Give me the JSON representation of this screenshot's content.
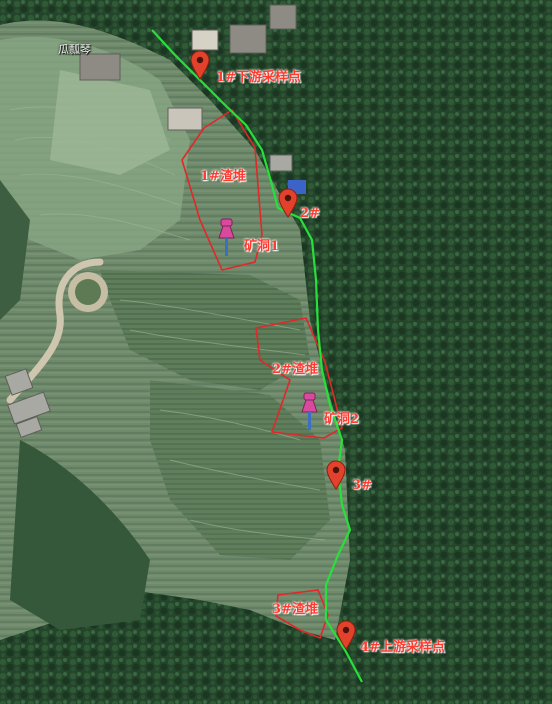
{
  "map": {
    "village_name": "瓜瓢琴",
    "colors": {
      "stream": "#27e03a",
      "waste_outline": "#e0282a",
      "sample_pin": "#e2422b",
      "mine_pin": "#d94a9e",
      "label_text": "#ff3b30"
    },
    "sampling_points": [
      {
        "id": "sp1",
        "label": "1#下游采样点",
        "icon": "map-pin-icon"
      },
      {
        "id": "sp2",
        "label": "2#",
        "icon": "map-pin-icon"
      },
      {
        "id": "sp3",
        "label": "3#",
        "icon": "map-pin-icon"
      },
      {
        "id": "sp4",
        "label": "4#上游采样点",
        "icon": "map-pin-icon"
      }
    ],
    "waste_piles": [
      {
        "id": "w1",
        "label": "1#渣堆"
      },
      {
        "id": "w2",
        "label": "2#渣堆"
      },
      {
        "id": "w3",
        "label": "3#渣堆"
      }
    ],
    "mine_adits": [
      {
        "id": "m1",
        "label": "矿洞1",
        "icon": "pushpin-icon"
      },
      {
        "id": "m2",
        "label": "矿洞2",
        "icon": "pushpin-icon"
      }
    ]
  }
}
